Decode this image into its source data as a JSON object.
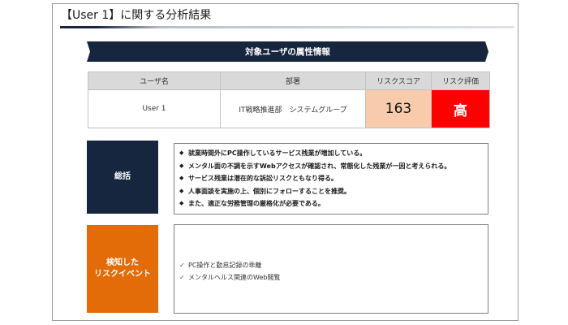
{
  "page": {
    "title": "【User 1】に関する分析結果"
  },
  "banner": {
    "label": "対象ユーザの属性情報"
  },
  "table": {
    "headers": [
      "ユーザ名",
      "部署",
      "リスクスコア",
      "リスク評価"
    ],
    "row": {
      "user": "User 1",
      "department": "IT戦略推進部　システムグループ",
      "risk_score": "163",
      "risk_level": "高"
    }
  },
  "summary": {
    "label": "総括",
    "bullet_icon": "diamond-bullet-icon",
    "items": [
      "就業時間外にPC操作しているサービス残業が増加している。",
      "メンタル面の不調を示すWebアクセスが確認され、常態化した残業が一因と考えられる。",
      "サービス残業は潜在的な訴訟リスクともなり得る。",
      "人事面談を実施の上、個別にフォローすることを推奨。",
      "また、適正な労務管理の厳格化が必要である。"
    ]
  },
  "risk_events": {
    "label_line1": "検知した",
    "label_line2": "リスクイベント",
    "check_icon": "checkmark-icon",
    "items": [
      "PC操作と勤怠記録の乖離",
      "メンタルヘルス関連のWeb閲覧"
    ]
  },
  "colors": {
    "navy": "#16263f",
    "orange": "#e36c09",
    "score_bg": "#f8cbad",
    "level_bg": "#ff0000",
    "header_bg": "#d9d9d9"
  }
}
